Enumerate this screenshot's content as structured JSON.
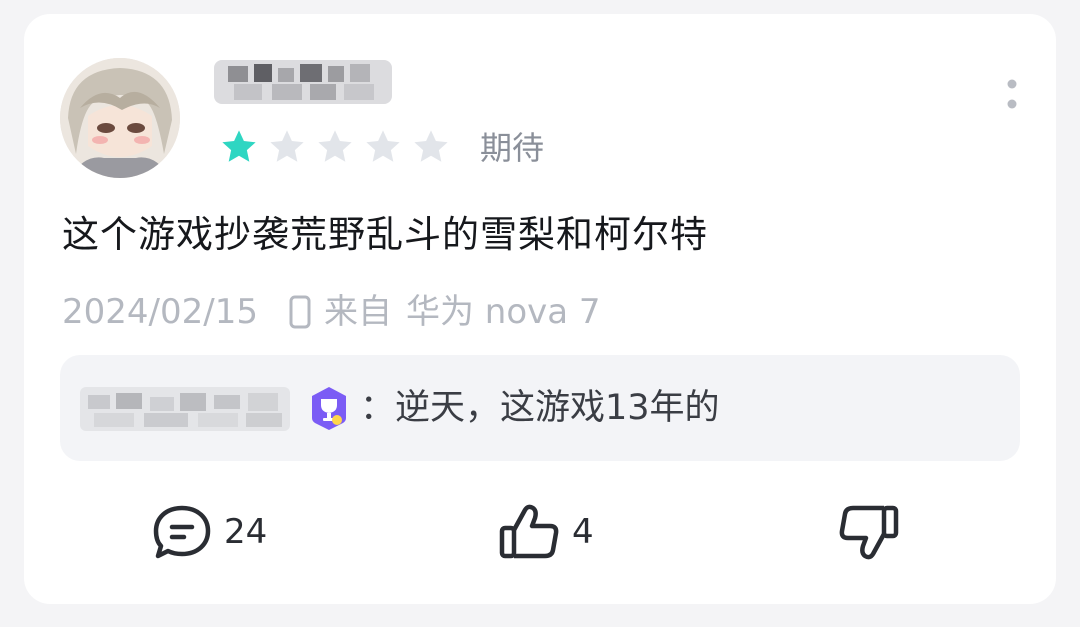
{
  "review": {
    "rating": 1,
    "rating_max": 5,
    "rating_label": "期待",
    "text": "这个游戏抄袭荒野乱斗的雪梨和柯尔特",
    "date": "2024/02/15",
    "device_prefix": "来自",
    "device": "华为 nova 7"
  },
  "reply": {
    "text": "：逆天，这游戏13年的"
  },
  "actions": {
    "comment_count": "24",
    "like_count": "4"
  },
  "colors": {
    "star_filled": "#2fd6c2",
    "star_empty": "#e2e5ea",
    "badge": "#7b5cf5"
  },
  "icons": {
    "menu": "more-vertical-icon",
    "device": "phone-icon",
    "badge": "trophy-badge-icon",
    "comment": "comment-icon",
    "like": "thumbs-up-icon",
    "dislike": "thumbs-down-icon"
  }
}
